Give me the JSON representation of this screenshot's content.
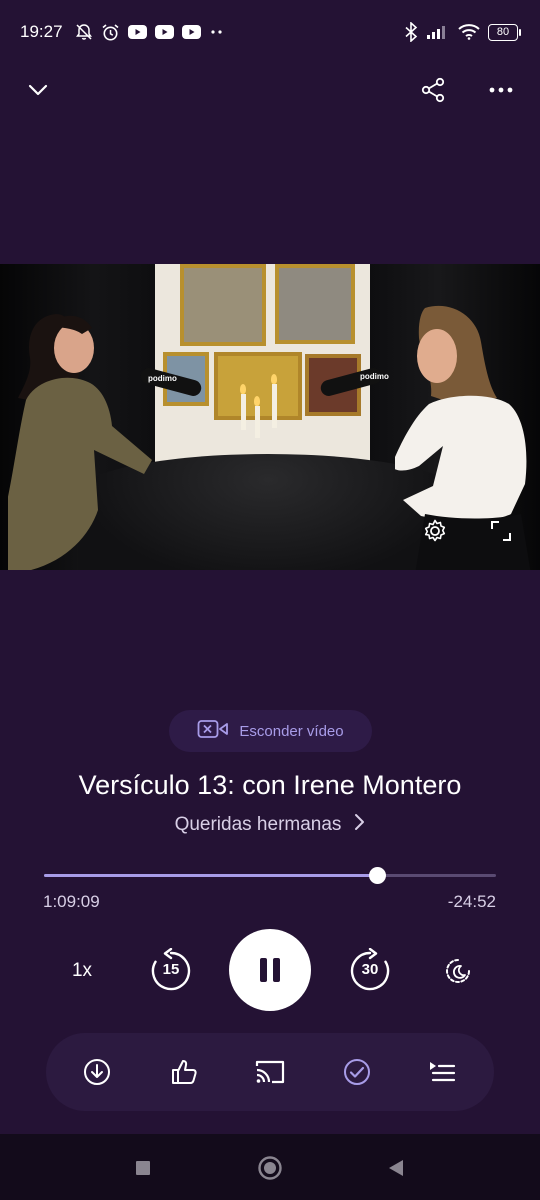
{
  "status_bar": {
    "time": "19:27",
    "battery": "80",
    "left_icons": [
      "muted-bell-icon",
      "alarm-icon",
      "youtube-icon",
      "youtube-icon",
      "youtube-icon",
      "more-dots-icon"
    ],
    "right_icons": [
      "bluetooth-icon",
      "signal-icon",
      "wifi-icon",
      "battery-icon"
    ]
  },
  "top_bar": {
    "icons": [
      "chevron-down-icon",
      "share-icon",
      "more-horizontal-icon"
    ]
  },
  "video": {
    "icons": [
      "settings-icon",
      "fullscreen-icon"
    ],
    "mic_brand": "podimo"
  },
  "hide_video": {
    "label": "Esconder vídeo",
    "icon": "hide-video-icon"
  },
  "episode": {
    "title": "Versículo 13: con Irene Montero",
    "show_name": "Queridas hermanas"
  },
  "playback": {
    "elapsed": "1:09:09",
    "remaining": "-24:52",
    "progress_fraction": 0.736,
    "speed": "1x",
    "skip_back_seconds": "15",
    "skip_forward_seconds": "30",
    "state": "playing"
  },
  "action_bar": {
    "icons": [
      "download-icon",
      "thumbs-up-icon",
      "cast-icon",
      "check-circle-icon",
      "queue-icon"
    ]
  },
  "colors": {
    "background": "#241234",
    "accent": "#a89ce8",
    "action_bar_bg": "#2c1a40"
  }
}
